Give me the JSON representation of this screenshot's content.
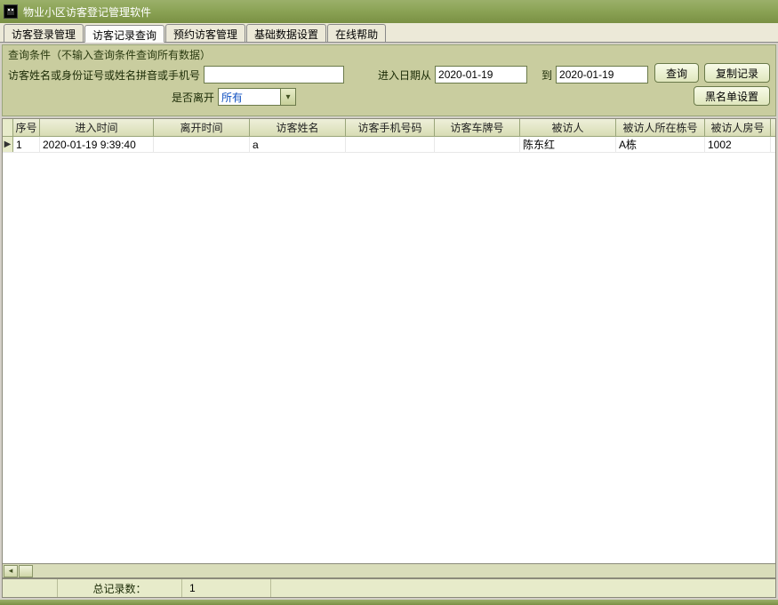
{
  "titlebar": {
    "title": "物业小区访客登记管理软件"
  },
  "tabs": [
    {
      "label": "访客登录管理",
      "active": false
    },
    {
      "label": "访客记录查询",
      "active": true
    },
    {
      "label": "预约访客管理",
      "active": false
    },
    {
      "label": "基础数据设置",
      "active": false
    },
    {
      "label": "在线帮助",
      "active": false
    }
  ],
  "search": {
    "legend": "查询条件（不输入查询条件查询所有数据）",
    "name_label": "访客姓名或身份证号或姓名拼音或手机号",
    "name_value": "",
    "date_from_label": "进入日期从",
    "date_from": "2020-01-19",
    "date_to_label": "到",
    "date_to": "2020-01-19",
    "left_label2": "是否离开",
    "left_value": "所有",
    "btn_query": "查询",
    "btn_copy": "复制记录",
    "btn_blacklist": "黑名单设置"
  },
  "grid": {
    "headers": {
      "seq": "序号",
      "in": "进入时间",
      "out": "离开时间",
      "name": "访客姓名",
      "phone": "访客手机号码",
      "plate": "访客车牌号",
      "visitee": "被访人",
      "bldg": "被访人所在栋号",
      "room": "被访人房号"
    },
    "rows": [
      {
        "seq": "1",
        "in": "2020-01-19 9:39:40",
        "out": "",
        "name": "a",
        "phone": "",
        "plate": "",
        "visitee": "陈东红",
        "bldg": "A栋",
        "room": "1002"
      }
    ]
  },
  "status": {
    "label": "总记录数：",
    "value": "1"
  }
}
